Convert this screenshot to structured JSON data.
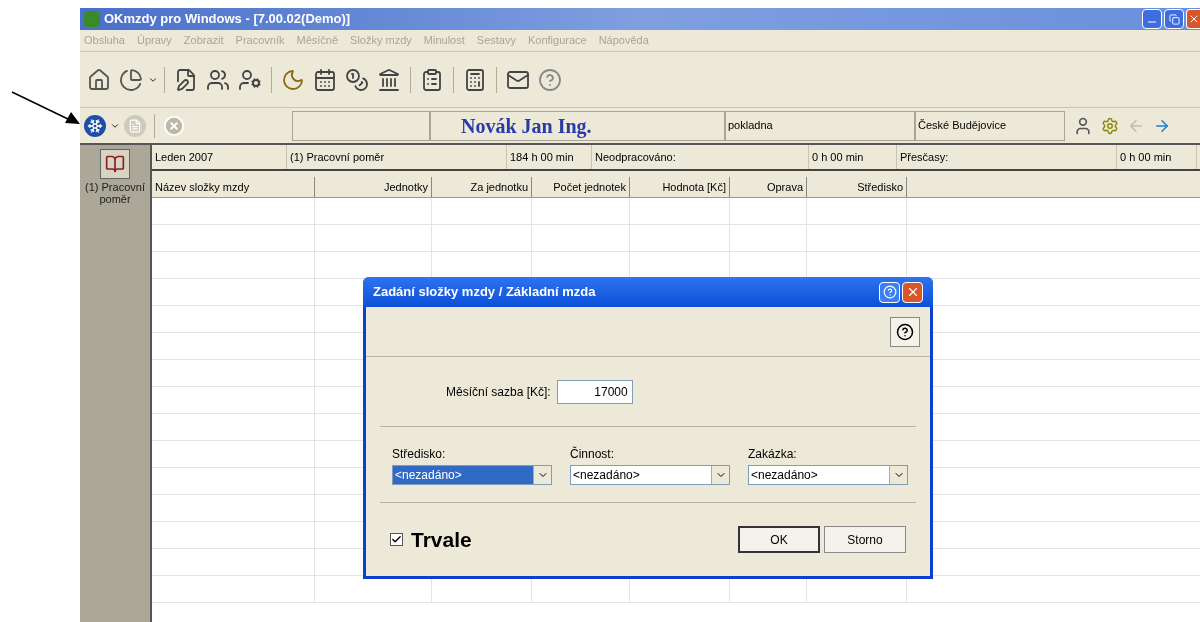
{
  "window": {
    "title": "OKmzdy pro Windows - [7.00.02(Demo)]"
  },
  "menu": [
    "Obsluha",
    "Úpravy",
    "Zobrazit",
    "Pracovník",
    "Měsíčně",
    "Složky mzdy",
    "Minulost",
    "Sestavy",
    "Konfigurace",
    "Nápověda"
  ],
  "employee_bar": {
    "name": "Novák Jan Ing.",
    "department": "pokladna",
    "location": "České Budějovice"
  },
  "sidebar": {
    "items": [
      {
        "label": "(1) Pracovní poměr",
        "selected": true
      }
    ]
  },
  "info_row": [
    "Leden 2007",
    "(1) Pracovní poměr",
    "184 h 00 min",
    "Neodpracováno:",
    "0 h 00 min",
    "Přesčasy:",
    "0 h 00 min"
  ],
  "table": {
    "columns": [
      "Název složky mzdy",
      "Jednotky",
      "Za jednotku",
      "Počet jednotek",
      "Hodnota [Kč]",
      "Oprava",
      "Středisko"
    ]
  },
  "dialog": {
    "title": "Zadání složky mzdy / Základní mzda",
    "rate_label": "Měsíční sazba [Kč]:",
    "rate_value": "17000",
    "dropdowns": [
      {
        "label": "Středisko:",
        "value": "<nezadáno>",
        "selected": true
      },
      {
        "label": "Činnost:",
        "value": "<nezadáno>",
        "selected": false
      },
      {
        "label": "Zakázka:",
        "value": "<nezadáno>",
        "selected": false
      }
    ],
    "permanent": {
      "label": "Trvale",
      "checked": true
    },
    "buttons": [
      "OK",
      "Storno"
    ]
  }
}
